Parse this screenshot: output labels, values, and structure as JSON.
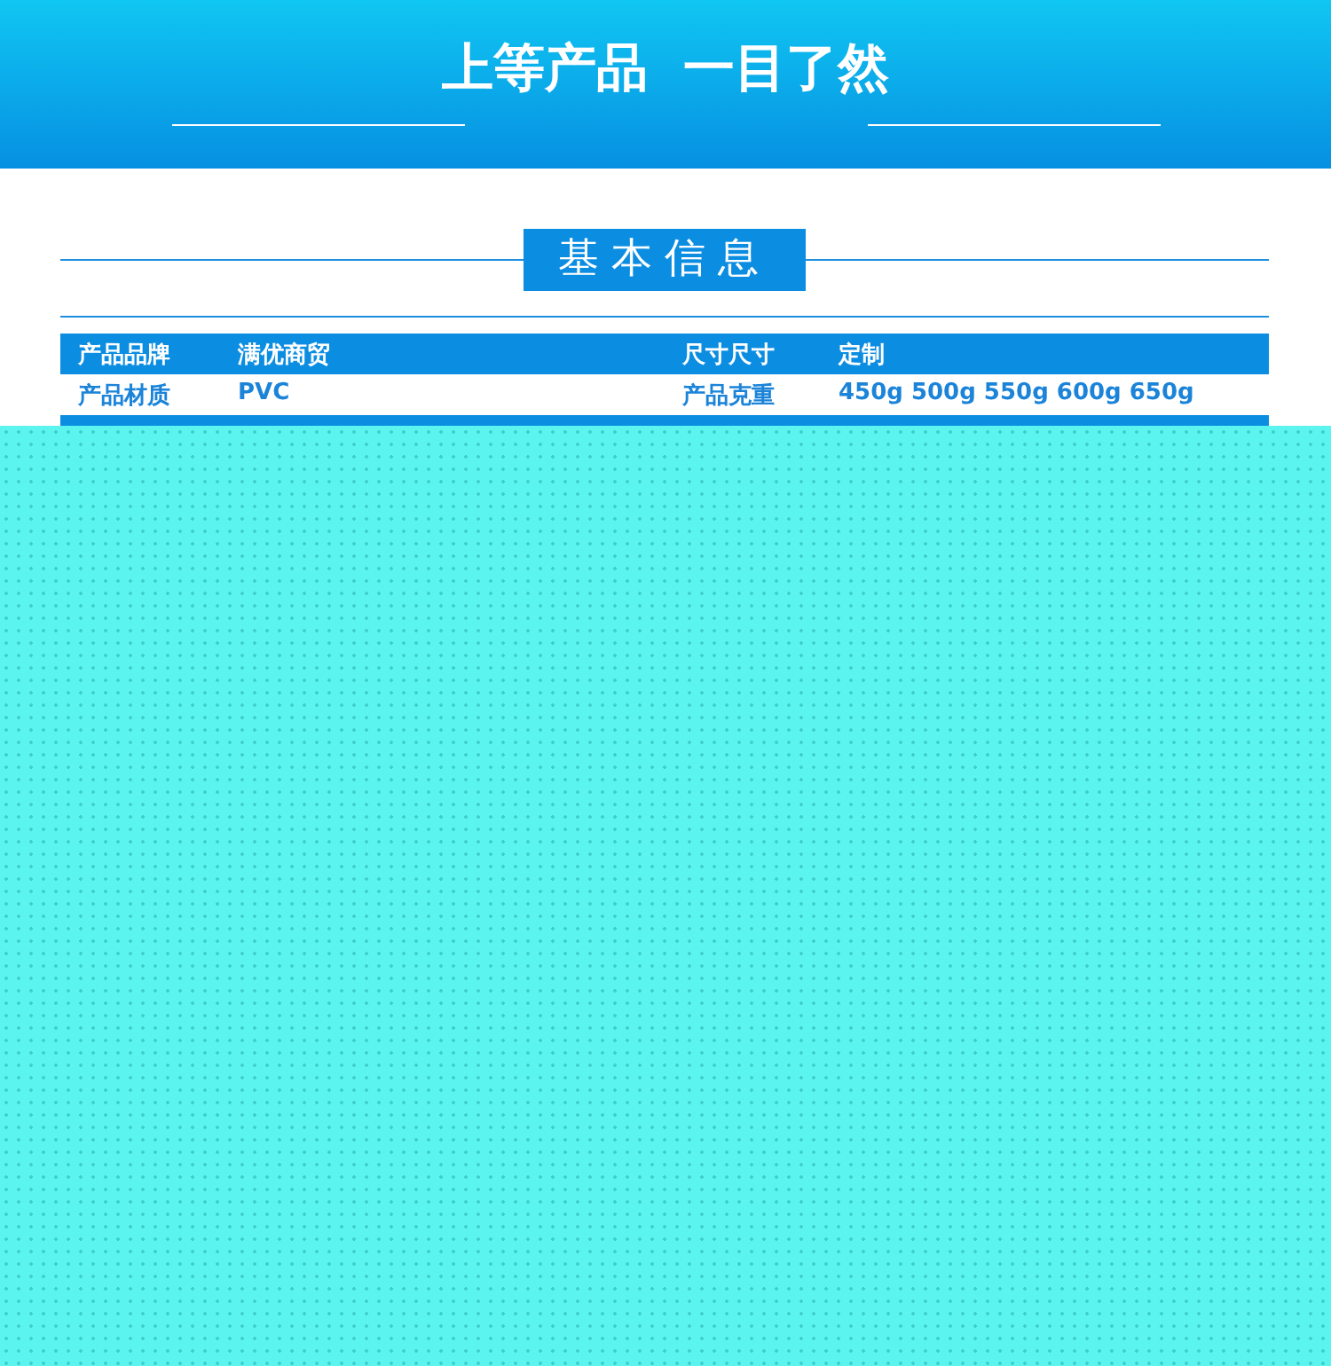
{
  "banner": {
    "title": "上等产品  一目了然"
  },
  "section": {
    "title": "基本信息"
  },
  "table": {
    "rows": [
      {
        "shaded": true,
        "cells": [
          {
            "label": "产品品牌",
            "value": "满优商贸"
          },
          {
            "label": "尺寸尺寸",
            "value": "定制"
          }
        ]
      },
      {
        "shaded": false,
        "cells": [
          {
            "label": "产品材质",
            "value": "PVC"
          },
          {
            "label": "产品克重",
            "value": "450g 500g 550g 600g 650g"
          }
        ]
      },
      {
        "shaded": true,
        "cells": []
      }
    ]
  }
}
